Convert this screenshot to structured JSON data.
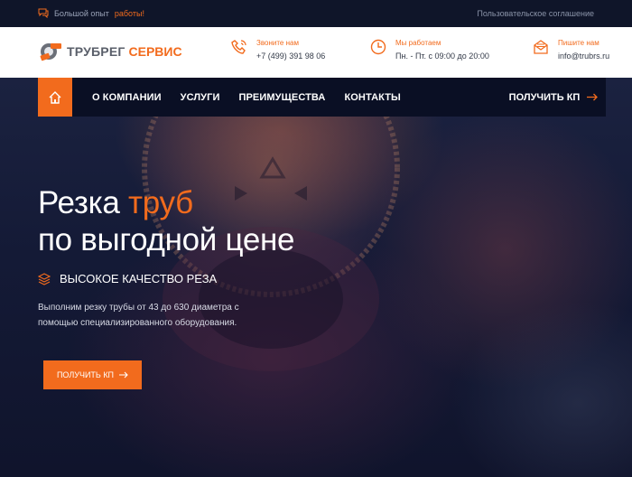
{
  "topbar": {
    "promo_prefix": "Большой опыт",
    "promo_accent": "работы!",
    "agreement_link": "Пользовательское соглашение"
  },
  "logo": {
    "part1": "ТРУБРЕГ",
    "part2": "СЕРВИС"
  },
  "contacts": [
    {
      "label": "Звоните нам",
      "value": "+7 (499) 391 98 06",
      "icon": "phone-icon"
    },
    {
      "label": "Мы работаем",
      "value": "Пн. - Пт. с 09:00 до 20:00",
      "icon": "clock-icon"
    },
    {
      "label": "Пишите нам",
      "value": "info@trubrs.ru",
      "icon": "mail-icon"
    }
  ],
  "nav": {
    "items": [
      "О КОМПАНИИ",
      "УСЛУГИ",
      "ПРЕИМУЩЕСТВА",
      "КОНТАКТЫ"
    ],
    "cta": "ПОЛУЧИТЬ КП"
  },
  "hero": {
    "title_part1": "Резка",
    "title_accent": "труб",
    "title_line2": "по выгодной цене",
    "feature": "ВЫСОКОЕ КАЧЕСТВО РЕЗА",
    "description": "Выполним резку трубы от 43 до 630 диаметра с помощью специализированного оборудования.",
    "button": "ПОЛУЧИТЬ КП"
  },
  "colors": {
    "accent": "#f26b1d",
    "dark": "#0a0f24"
  }
}
